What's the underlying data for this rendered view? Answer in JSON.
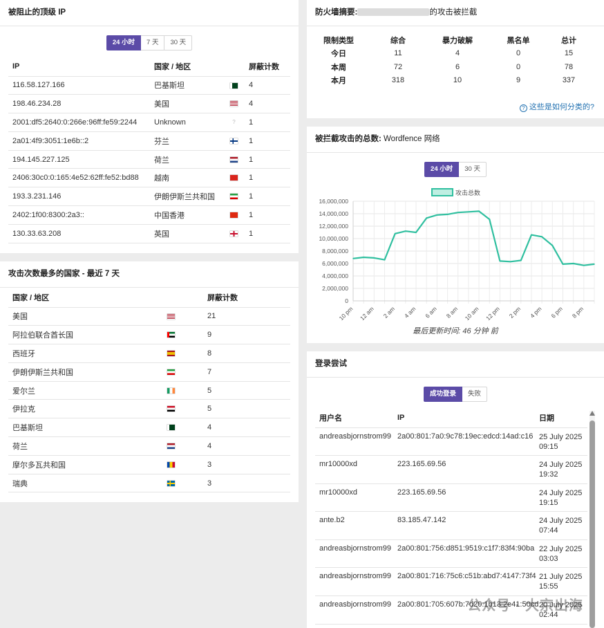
{
  "top_ips": {
    "title": "被阻止的顶级 IP",
    "tabs": [
      "24 小时",
      "7 天",
      "30 天"
    ],
    "active_tab": 0,
    "headers": [
      "IP",
      "国家 / 地区",
      "屏蔽计数"
    ],
    "rows": [
      {
        "ip": "116.58.127.166",
        "country": "巴基斯坦",
        "flag": "pk",
        "count": "4"
      },
      {
        "ip": "198.46.234.28",
        "country": "美国",
        "flag": "us",
        "count": "4"
      },
      {
        "ip": "2001:df5:2640:0:266e:96ff:fe59:2244",
        "country": "Unknown",
        "flag": "unknown",
        "count": "1"
      },
      {
        "ip": "2a01:4f9:3051:1e6b::2",
        "country": "芬兰",
        "flag": "fi",
        "count": "1"
      },
      {
        "ip": "194.145.227.125",
        "country": "荷兰",
        "flag": "nl",
        "count": "1"
      },
      {
        "ip": "2406:30c0:0:165:4e52:62ff:fe52:bd88",
        "country": "越南",
        "flag": "vn",
        "count": "1"
      },
      {
        "ip": "193.3.231.146",
        "country": "伊朗伊斯兰共和国",
        "flag": "ir",
        "count": "1"
      },
      {
        "ip": "2402:1f00:8300:2a3::",
        "country": "中国香港",
        "flag": "hk",
        "count": "1"
      },
      {
        "ip": "130.33.63.208",
        "country": "英国",
        "flag": "gb",
        "count": "1"
      }
    ]
  },
  "top_countries": {
    "title": "攻击次数最多的国家 - 最近 7 天",
    "headers": [
      "国家 / 地区",
      "屏蔽计数"
    ],
    "rows": [
      {
        "country": "美国",
        "flag": "us",
        "count": "21"
      },
      {
        "country": "阿拉伯联合酋长国",
        "flag": "ae",
        "count": "9"
      },
      {
        "country": "西班牙",
        "flag": "es",
        "count": "8"
      },
      {
        "country": "伊朗伊斯兰共和国",
        "flag": "ir",
        "count": "7"
      },
      {
        "country": "爱尔兰",
        "flag": "ie",
        "count": "5"
      },
      {
        "country": "伊拉克",
        "flag": "iq",
        "count": "5"
      },
      {
        "country": "巴基斯坦",
        "flag": "pk",
        "count": "4"
      },
      {
        "country": "荷兰",
        "flag": "nl",
        "count": "4"
      },
      {
        "country": "摩尔多瓦共和国",
        "flag": "md",
        "count": "3"
      },
      {
        "country": "瑞典",
        "flag": "se",
        "count": "3"
      }
    ]
  },
  "firewall": {
    "title_prefix": "防火墙摘要:",
    "title_suffix": "的攻击被拦截",
    "headers": [
      "限制类型",
      "综合",
      "暴力破解",
      "黑名单",
      "总计"
    ],
    "rows": [
      {
        "label": "今日",
        "values": [
          "11",
          "4",
          "0",
          "15"
        ]
      },
      {
        "label": "本周",
        "values": [
          "72",
          "6",
          "0",
          "78"
        ]
      },
      {
        "label": "本月",
        "values": [
          "318",
          "10",
          "9",
          "337"
        ]
      }
    ],
    "help_link": "这些是如何分类的?"
  },
  "attacks": {
    "title_bold": "被拦截攻击的总数:",
    "title_plain": " Wordfence 网络",
    "tabs": [
      "24 小时",
      "30 天"
    ],
    "active_tab": 0,
    "updated": "最后更新时间: 46 分钟 前"
  },
  "chart_data": {
    "type": "line",
    "legend": "攻击总数",
    "color": "#2fbf9f",
    "ylim": [
      0,
      16000000
    ],
    "yticks": [
      "0",
      "2,000,000",
      "4,000,000",
      "6,000,000",
      "8,000,000",
      "10,000,000",
      "12,000,000",
      "14,000,000",
      "16,000,000"
    ],
    "xticks": [
      "10 pm",
      "12 am",
      "2 am",
      "4 am",
      "6 am",
      "8 am",
      "10 am",
      "12 pm",
      "2 pm",
      "4 pm",
      "6 pm",
      "8 pm"
    ],
    "x": [
      0,
      1,
      2,
      3,
      4,
      5,
      6,
      7,
      8,
      9,
      10,
      11,
      12,
      13,
      14,
      15,
      16,
      17,
      18,
      19,
      20,
      21,
      22,
      23
    ],
    "values": [
      6800000,
      7000000,
      6900000,
      6600000,
      10800000,
      11200000,
      11000000,
      13300000,
      13800000,
      13900000,
      14200000,
      14300000,
      14400000,
      13100000,
      6400000,
      6300000,
      6500000,
      10600000,
      10300000,
      8900000,
      5900000,
      6000000,
      5700000,
      5900000
    ]
  },
  "logins": {
    "title": "登录尝试",
    "tabs": [
      "成功登录",
      "失败"
    ],
    "active_tab": 0,
    "headers": [
      "用户名",
      "IP",
      "日期"
    ],
    "rows": [
      {
        "user": "andreasbjornstrom99",
        "ip": "2a00:801:7a0:9c78:19ec:edcd:14ad:c16",
        "date": "25 July 2025",
        "time": "09:15"
      },
      {
        "user": "mr10000xd",
        "ip": "223.165.69.56",
        "date": "24 July 2025",
        "time": "19:32"
      },
      {
        "user": "mr10000xd",
        "ip": "223.165.69.56",
        "date": "24 July 2025",
        "time": "19:15"
      },
      {
        "user": "ante.b2",
        "ip": "83.185.47.142",
        "date": "24 July 2025",
        "time": "07:44"
      },
      {
        "user": "andreasbjornstrom99",
        "ip": "2a00:801:756:d851:9519:c1f7:83f4:90ba",
        "date": "22 July 2025",
        "time": "03:03"
      },
      {
        "user": "andreasbjornstrom99",
        "ip": "2a00:801:716:75c6:c51b:abd7:4147:73f4",
        "date": "21 July 2025",
        "time": "15:55"
      },
      {
        "user": "andreasbjornstrom99",
        "ip": "2a00:801:705:607b:7d20:1b13:2e41:50cd",
        "date": "20 July 2025",
        "time": "02:44"
      }
    ]
  },
  "watermark": "公众号 · 大京出海"
}
